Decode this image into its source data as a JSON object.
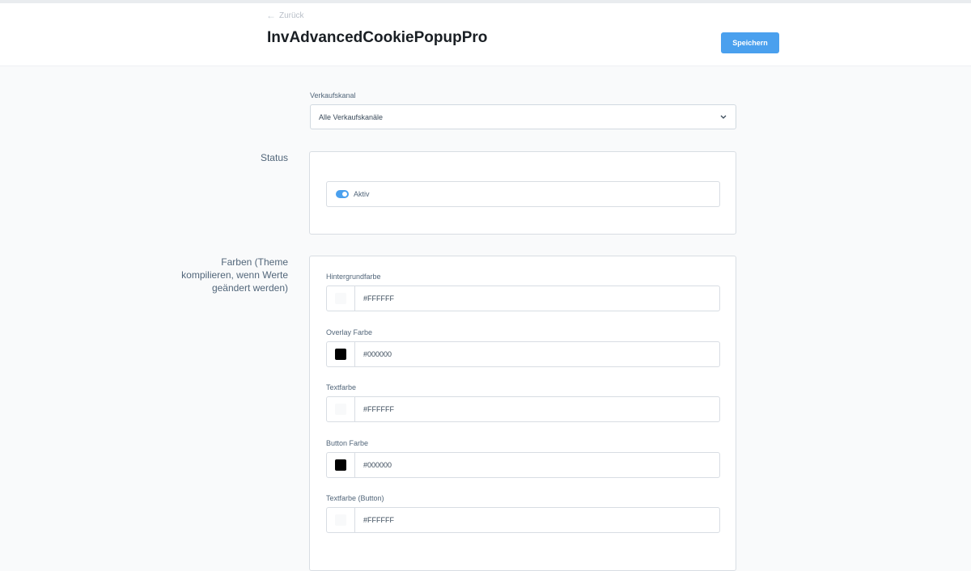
{
  "header": {
    "back_label": "Zurück",
    "title": "InvAdvancedCookiePopupPro",
    "save_label": "Speichern"
  },
  "sales_channel": {
    "label": "Verkaufskanal",
    "selected": "Alle Verkaufskanäle"
  },
  "status": {
    "section_label": "Status",
    "toggle_label": "Aktiv",
    "active": true
  },
  "colors": {
    "section_label_line1": "Farben (Theme",
    "section_label_line2": "kompilieren, wenn Werte",
    "section_label_line3": "geändert werden)",
    "fields": [
      {
        "label": "Hintergrundfarbe",
        "value": "#FFFFFF",
        "swatch": "#ffffff"
      },
      {
        "label": "Overlay Farbe",
        "value": "#000000",
        "swatch": "#000000"
      },
      {
        "label": "Textfarbe",
        "value": "#FFFFFF",
        "swatch": "#ffffff"
      },
      {
        "label": "Button Farbe",
        "value": "#000000",
        "swatch": "#000000"
      },
      {
        "label": "Textfarbe (Button)",
        "value": "#FFFFFF",
        "swatch": "#ffffff"
      }
    ]
  },
  "theme": {
    "accent": "#4aa0ee"
  }
}
